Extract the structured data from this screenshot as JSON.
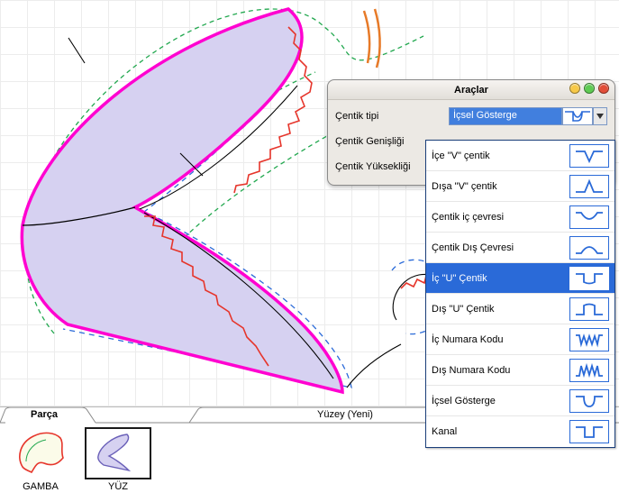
{
  "tabs": {
    "part": "Parça",
    "surface": "Yüzey (Yeni)"
  },
  "parts": [
    {
      "label": "GAMBA",
      "selected": false
    },
    {
      "label": "YÜZ",
      "selected": true
    }
  ],
  "tools_panel": {
    "title": "Araçlar",
    "rows": {
      "notch_type_label": "Çentik tipi",
      "notch_type_value": "İçsel Gösterge",
      "notch_width_label": "Çentik Genişliği",
      "notch_height_label": "Çentik Yüksekliği"
    }
  },
  "notch_dropdown": {
    "selected_index": 4,
    "items": [
      {
        "label": "İçe \"V\" çentik",
        "icon": "v-in"
      },
      {
        "label": "Dışa \"V\" çentik",
        "icon": "v-out"
      },
      {
        "label": "Çentik iç çevresi",
        "icon": "u-in-wide"
      },
      {
        "label": "Çentik Dış Çevresi",
        "icon": "u-out-wide"
      },
      {
        "label": "İç \"U\" Çentik",
        "icon": "u-in"
      },
      {
        "label": "Dış \"U\" Çentik",
        "icon": "u-out"
      },
      {
        "label": "İç Numara Kodu",
        "icon": "num-in"
      },
      {
        "label": "Dış Numara Kodu",
        "icon": "num-out"
      },
      {
        "label": "İçsel Gösterge",
        "icon": "indicator"
      },
      {
        "label": "Kanal",
        "icon": "channel"
      }
    ]
  },
  "colors": {
    "grid": "#ececec",
    "outline": "#ff00d0",
    "fill": "#d5d0f2",
    "guide_green": "#22a84f",
    "guide_blue": "#2a6ad8",
    "notch_red": "#e6352b",
    "selection": "#2a6ad8"
  }
}
